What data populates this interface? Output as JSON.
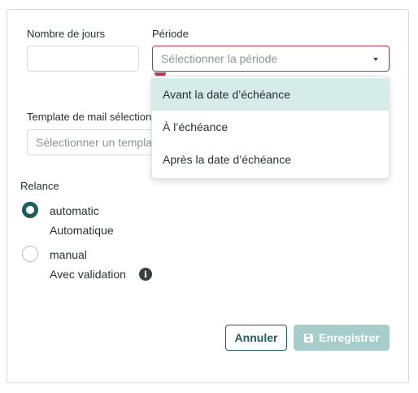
{
  "form": {
    "days_label": "Nombre de jours",
    "days_value": "",
    "period_label": "Période",
    "period_placeholder": "Sélectionner la période",
    "template_label": "Template de mail sélectionné",
    "template_placeholder": "Sélectionner un template"
  },
  "period_dropdown": {
    "options": [
      {
        "label": "Avant la date d’échéance",
        "highlighted": true
      },
      {
        "label": "À l’échéance",
        "highlighted": false
      },
      {
        "label": "Après la date d’échéance",
        "highlighted": false
      }
    ]
  },
  "relance": {
    "label": "Relance",
    "options": [
      {
        "value": "automatic",
        "description": "Automatique",
        "checked": true
      },
      {
        "value": "manual",
        "description": "Avec validation",
        "checked": false
      }
    ]
  },
  "actions": {
    "cancel_label": "Annuler",
    "save_label": "Enregistrer",
    "save_disabled": true
  },
  "colors": {
    "primary": "#1d5f5c",
    "error": "#b8334d",
    "highlight": "#d6ece9",
    "disabled_primary": "#a6cdca"
  },
  "icons": {
    "period_caret": "chevron-down-icon",
    "validation_info": "info-icon",
    "save": "save-icon"
  }
}
